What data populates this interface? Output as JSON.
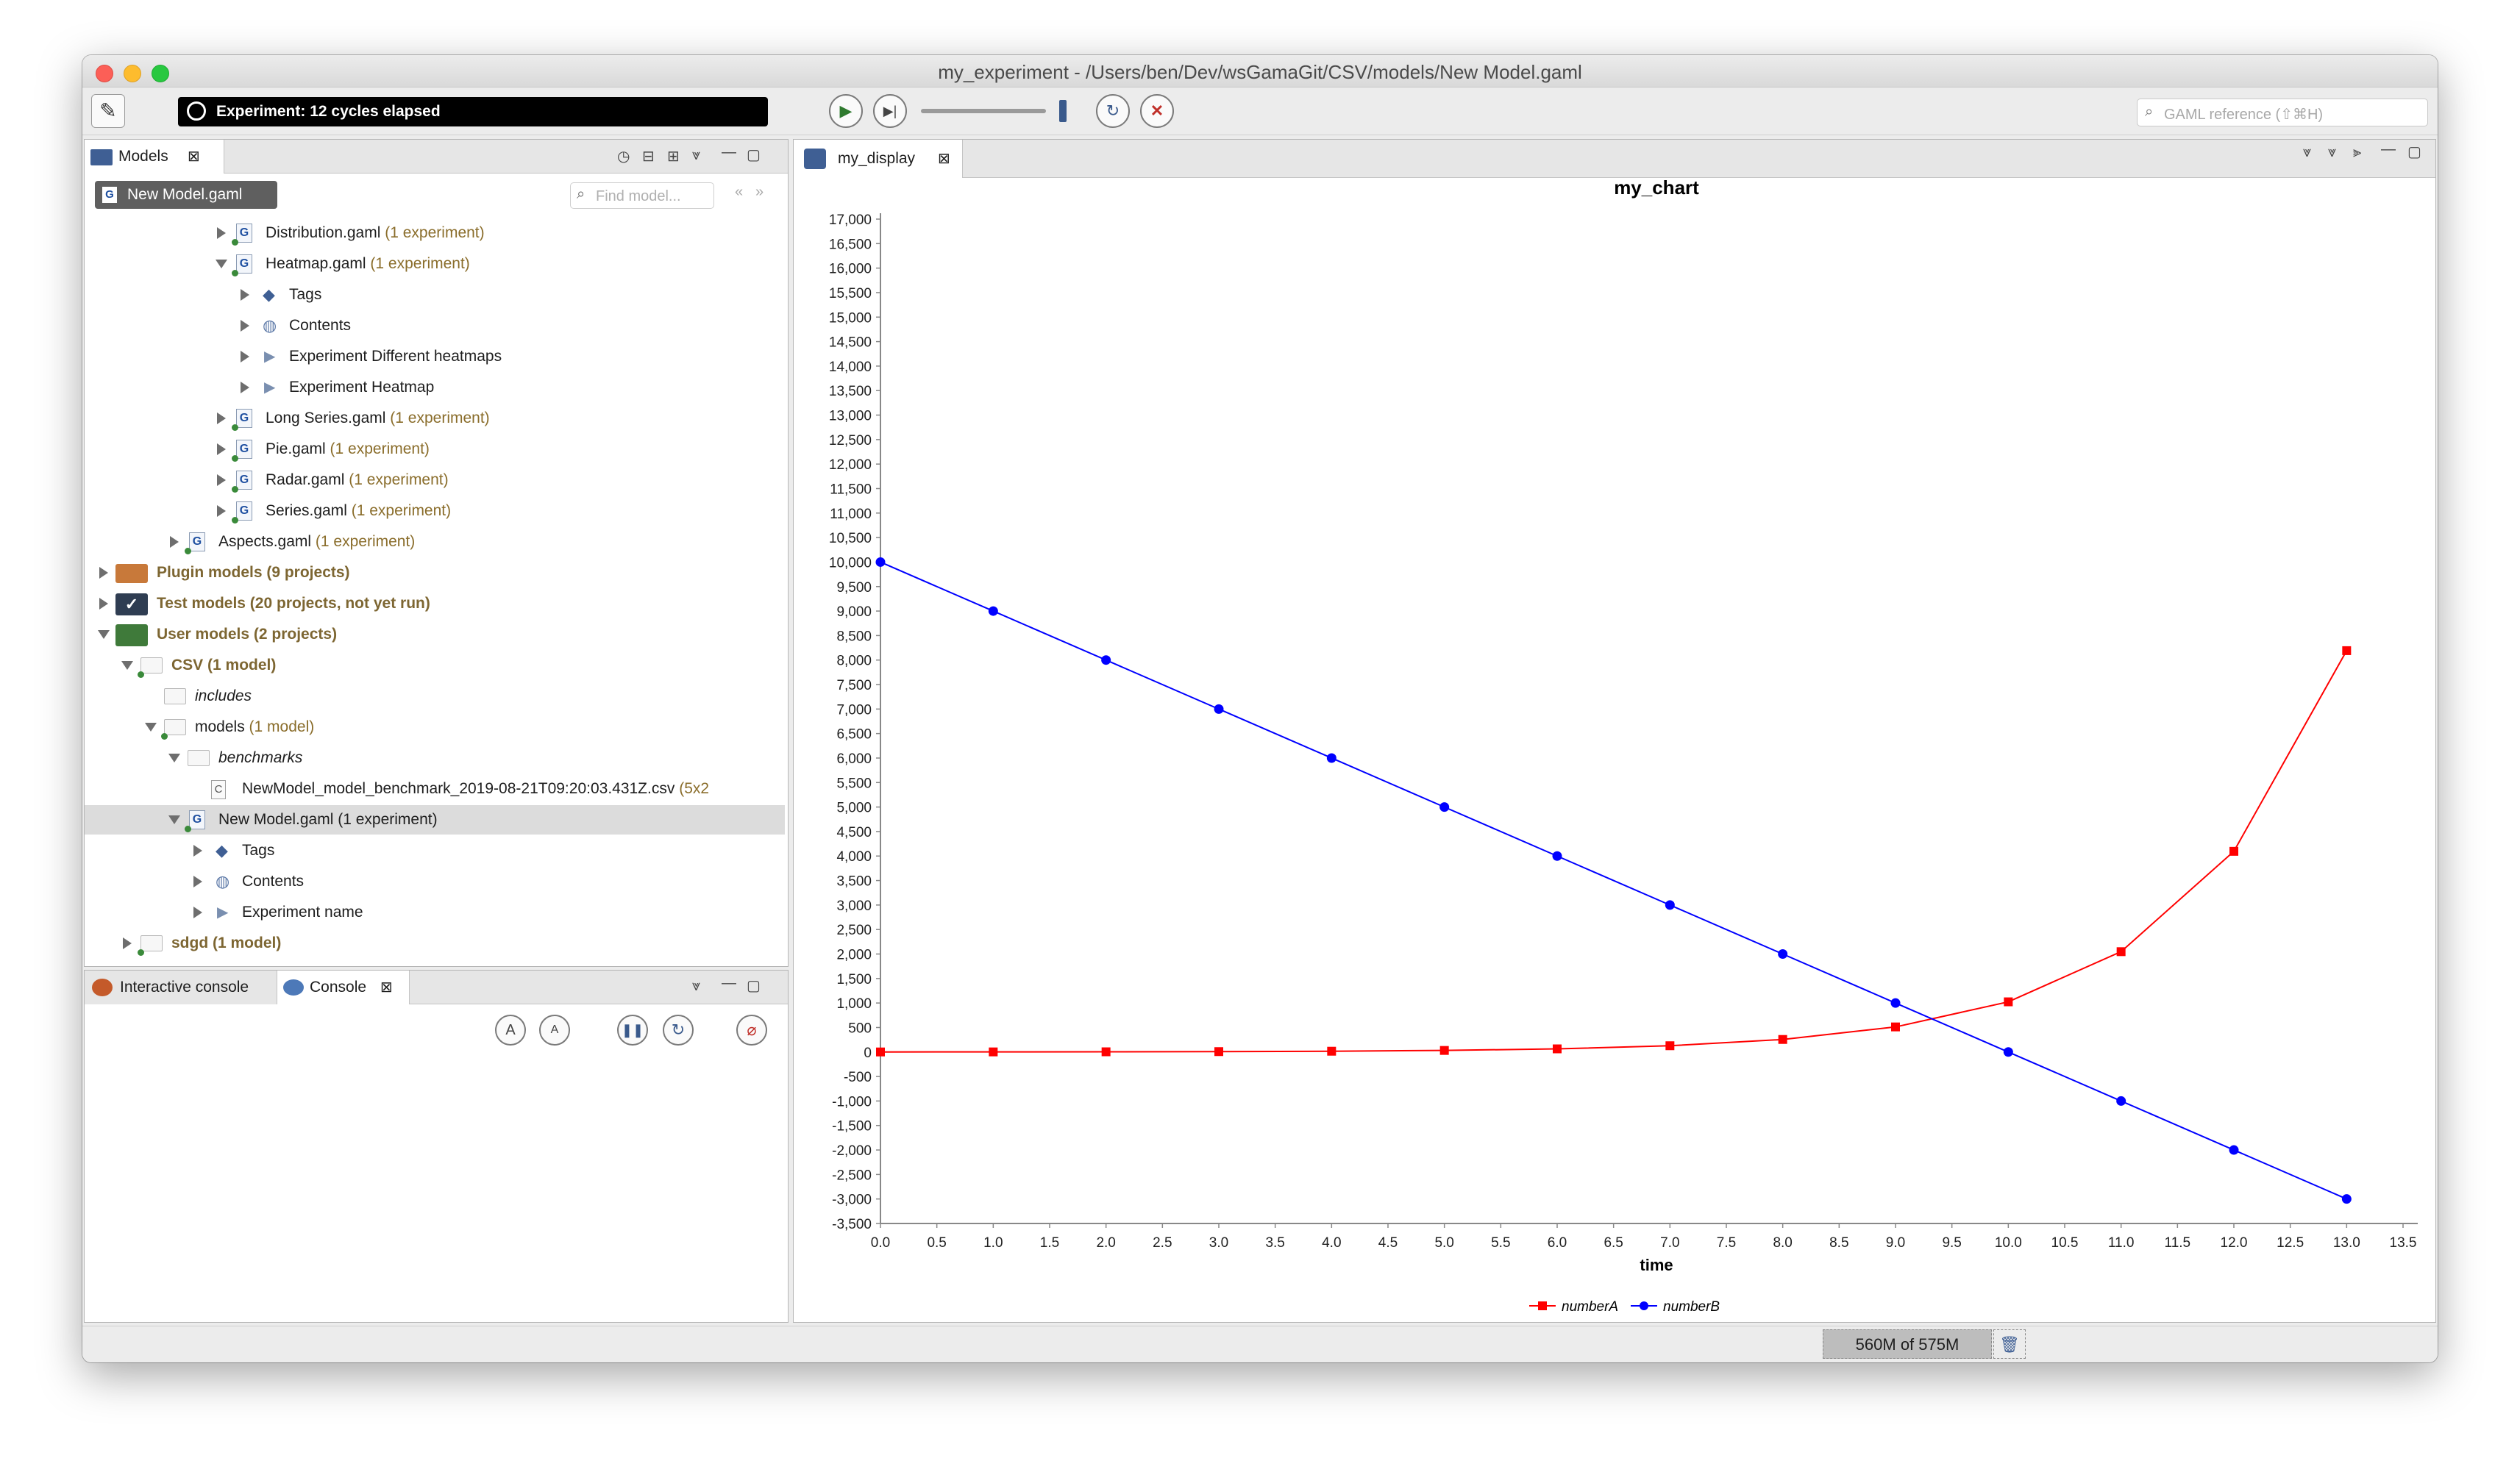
{
  "window": {
    "title": "my_experiment - /Users/ben/Dev/wsGamaGit/CSV/models/New Model.gaml"
  },
  "toolbar": {
    "status": "Experiment: 12 cycles elapsed",
    "search_placeholder": "GAML reference (⇧⌘H)"
  },
  "models_panel": {
    "tab_label": "Models",
    "current_file": "New Model.gaml",
    "find_placeholder": "Find model..."
  },
  "tree": {
    "distribution": {
      "name": "Distribution.gaml",
      "count": "(1 experiment)"
    },
    "heatmap": {
      "name": "Heatmap.gaml",
      "count": "(1 experiment)"
    },
    "heatmap_tags": "Tags",
    "heatmap_contents": "Contents",
    "heatmap_exp1": "Experiment Different heatmaps",
    "heatmap_exp2": "Experiment Heatmap",
    "long_series": {
      "name": "Long Series.gaml",
      "count": "(1 experiment)"
    },
    "pie": {
      "name": "Pie.gaml",
      "count": "(1 experiment)"
    },
    "radar": {
      "name": "Radar.gaml",
      "count": "(1 experiment)"
    },
    "series": {
      "name": "Series.gaml",
      "count": "(1 experiment)"
    },
    "aspects": {
      "name": "Aspects.gaml",
      "count": "(1 experiment)"
    },
    "plugin_models": "Plugin models (9 projects)",
    "test_models": "Test models (20 projects, not yet run)",
    "user_models": "User models (2 projects)",
    "csv": "CSV (1 model)",
    "includes": "includes",
    "models": {
      "name": "models",
      "count": "(1 model)"
    },
    "benchmarks": "benchmarks",
    "csv_file": {
      "name": "NewModel_model_benchmark_2019-08-21T09:20:03.431Z.csv",
      "count": "(5x2"
    },
    "new_model": "New Model.gaml (1 experiment)",
    "nm_tags": "Tags",
    "nm_contents": "Contents",
    "nm_experiment": "Experiment name",
    "sdgd": "sdgd (1 model)"
  },
  "console": {
    "tab_interactive": "Interactive console",
    "tab_console": "Console"
  },
  "display": {
    "tab_label": "my_display"
  },
  "status_bar": {
    "memory": "560M of 575M"
  },
  "chart_data": {
    "type": "line",
    "title": "my_chart",
    "xlabel": "time",
    "ylabel": "",
    "xlim": [
      0,
      13.5
    ],
    "ylim": [
      -3500,
      17000
    ],
    "x": [
      0,
      1,
      2,
      3,
      4,
      5,
      6,
      7,
      8,
      9,
      10,
      11,
      12,
      13
    ],
    "series": [
      {
        "name": "numberA",
        "color": "#ff0000",
        "marker": "square",
        "values": [
          1,
          2,
          4,
          8,
          16,
          32,
          64,
          128,
          256,
          512,
          1024,
          2048,
          4096,
          8192
        ]
      },
      {
        "name": "numberB",
        "color": "#0000ff",
        "marker": "circle",
        "values": [
          10000,
          9000,
          8000,
          7000,
          6000,
          5000,
          4000,
          3000,
          2000,
          1000,
          0,
          -1000,
          -2000,
          -3000
        ]
      }
    ],
    "x_ticks": [
      "0.0",
      "0.5",
      "1.0",
      "1.5",
      "2.0",
      "2.5",
      "3.0",
      "3.5",
      "4.0",
      "4.5",
      "5.0",
      "5.5",
      "6.0",
      "6.5",
      "7.0",
      "7.5",
      "8.0",
      "8.5",
      "9.0",
      "9.5",
      "10.0",
      "10.5",
      "11.0",
      "11.5",
      "12.0",
      "12.5",
      "13.0",
      "13.5"
    ],
    "y_ticks": [
      "17,000",
      "16,500",
      "16,000",
      "15,500",
      "15,000",
      "14,500",
      "14,000",
      "13,500",
      "13,000",
      "12,500",
      "12,000",
      "11,500",
      "11,000",
      "10,500",
      "10,000",
      "9,500",
      "9,000",
      "8,500",
      "8,000",
      "7,500",
      "7,000",
      "6,500",
      "6,000",
      "5,500",
      "5,000",
      "4,500",
      "4,000",
      "3,500",
      "3,000",
      "2,500",
      "2,000",
      "1,500",
      "1,000",
      "500",
      "0",
      "-500",
      "-1,000",
      "-1,500",
      "-2,000",
      "-2,500",
      "-3,000",
      "-3,500"
    ],
    "grid": false,
    "legend": "bottom"
  }
}
